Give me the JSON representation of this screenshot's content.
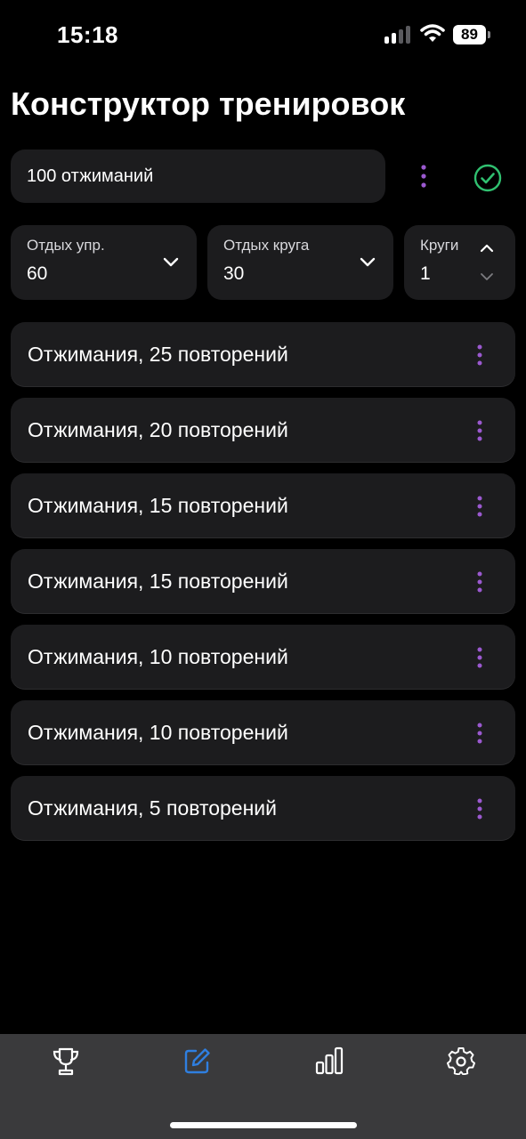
{
  "status_bar": {
    "time": "15:18",
    "battery": "89"
  },
  "header": {
    "title": "Конструктор тренировок"
  },
  "workout": {
    "name": "100 отжиманий"
  },
  "settings": {
    "exercise_rest": {
      "label": "Отдых упр.",
      "value": "60"
    },
    "round_rest": {
      "label": "Отдых круга",
      "value": "30"
    },
    "rounds": {
      "label": "Круги",
      "value": "1"
    }
  },
  "exercises": [
    {
      "label": "Отжимания, 25 повторений"
    },
    {
      "label": "Отжимания, 20 повторений"
    },
    {
      "label": "Отжимания, 15 повторений"
    },
    {
      "label": "Отжимания, 15 повторений"
    },
    {
      "label": "Отжимания, 10 повторений"
    },
    {
      "label": "Отжимания, 10 повторений"
    },
    {
      "label": "Отжимания, 5 повторений"
    }
  ],
  "tab_bar": {
    "tabs": [
      {
        "icon": "trophy-icon",
        "active": false
      },
      {
        "icon": "edit-icon",
        "active": true
      },
      {
        "icon": "stats-icon",
        "active": false
      },
      {
        "icon": "gear-icon",
        "active": false
      }
    ]
  },
  "colors": {
    "accent": "#9b59d0",
    "active_tab": "#2f7fe0",
    "success": "#30c070",
    "card": "#1c1c1e",
    "tab_bar": "#3a3a3c"
  }
}
